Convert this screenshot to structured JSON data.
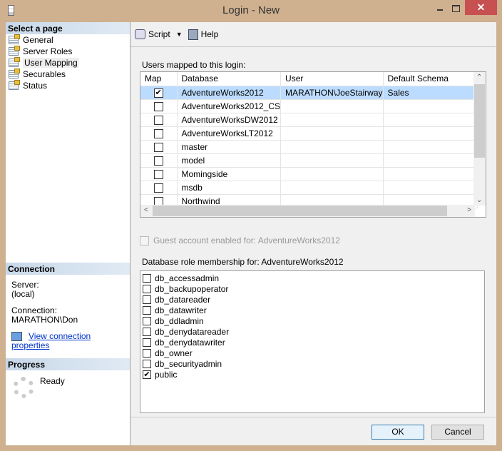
{
  "window": {
    "title": "Login - New",
    "close": "✕"
  },
  "sidebar": {
    "header": "Select a page",
    "items": [
      {
        "label": "General"
      },
      {
        "label": "Server Roles"
      },
      {
        "label": "User Mapping"
      },
      {
        "label": "Securables"
      },
      {
        "label": "Status"
      }
    ]
  },
  "connection": {
    "header": "Connection",
    "server_label": "Server:",
    "server": "(local)",
    "connection_label": "Connection:",
    "connection": "MARATHON\\Don",
    "link": "View connection properties"
  },
  "progress": {
    "header": "Progress",
    "status": "Ready"
  },
  "toolbar": {
    "script": "Script",
    "help": "Help"
  },
  "users_grid": {
    "label": "Users mapped to this login:",
    "columns": [
      "Map",
      "Database",
      "User",
      "Default Schema"
    ],
    "rows": [
      {
        "map": true,
        "database": "AdventureWorks2012",
        "user": "MARATHON\\JoeStairway",
        "schema": "Sales",
        "selected": true
      },
      {
        "map": false,
        "database": "AdventureWorks2012_CS",
        "user": "",
        "schema": ""
      },
      {
        "map": false,
        "database": "AdventureWorksDW2012",
        "user": "",
        "schema": ""
      },
      {
        "map": false,
        "database": "AdventureWorksLT2012",
        "user": "",
        "schema": ""
      },
      {
        "map": false,
        "database": "master",
        "user": "",
        "schema": ""
      },
      {
        "map": false,
        "database": "model",
        "user": "",
        "schema": ""
      },
      {
        "map": false,
        "database": "Momingside",
        "user": "",
        "schema": ""
      },
      {
        "map": false,
        "database": "msdb",
        "user": "",
        "schema": ""
      },
      {
        "map": false,
        "database": "Northwind",
        "user": "",
        "schema": ""
      }
    ]
  },
  "guest": {
    "label": "Guest account enabled for: AdventureWorks2012",
    "checked": false
  },
  "roles": {
    "label": "Database role membership for: AdventureWorks2012",
    "items": [
      {
        "name": "db_accessadmin",
        "checked": false
      },
      {
        "name": "db_backupoperator",
        "checked": false
      },
      {
        "name": "db_datareader",
        "checked": false
      },
      {
        "name": "db_datawriter",
        "checked": false
      },
      {
        "name": "db_ddladmin",
        "checked": false
      },
      {
        "name": "db_denydatareader",
        "checked": false
      },
      {
        "name": "db_denydatawriter",
        "checked": false
      },
      {
        "name": "db_owner",
        "checked": false
      },
      {
        "name": "db_securityadmin",
        "checked": false
      },
      {
        "name": "public",
        "checked": true
      }
    ]
  },
  "buttons": {
    "ok": "OK",
    "cancel": "Cancel"
  }
}
